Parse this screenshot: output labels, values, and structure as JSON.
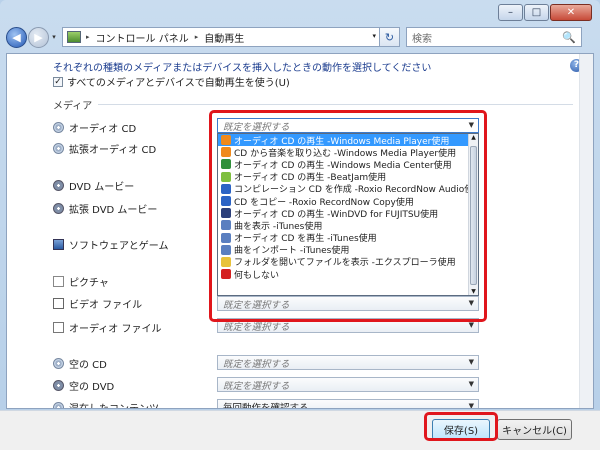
{
  "window": {
    "minimize": "–",
    "maximize": "□",
    "close": "✕"
  },
  "nav": {
    "back": "◀",
    "forward": "▶",
    "dropdown": "▾",
    "breadcrumb": [
      "コントロール パネル",
      "自動再生"
    ],
    "crumb_separator": "▸",
    "refresh": "↻",
    "search_placeholder": "検索",
    "search_icon": "search-icon"
  },
  "panel": {
    "help": "?",
    "instruction": "それぞれの種類のメディアまたはデバイスを挿入したときの動作を選択してください",
    "use_all_label": "すべてのメディアとデバイスで自動再生を使う(U)",
    "use_all_checked": true,
    "section_label": "メディア"
  },
  "media_rows": [
    {
      "label": "オーディオ CD",
      "icon": "audio-cd-icon",
      "value": "既定を選択する",
      "open": true
    },
    {
      "label": "拡張オーディオ CD",
      "icon": "enhanced-audio-cd-icon",
      "value": ""
    },
    {
      "label": "DVD ムービー",
      "icon": "dvd-movie-icon",
      "value": ""
    },
    {
      "label": "拡張 DVD ムービー",
      "icon": "enhanced-dvd-movie-icon",
      "value": ""
    },
    {
      "label": "ソフトウェアとゲーム",
      "icon": "software-games-icon",
      "value": ""
    },
    {
      "label": "ピクチャ",
      "icon": "pictures-icon",
      "value": ""
    },
    {
      "label": "ビデオ ファイル",
      "icon": "video-files-icon",
      "value": "既定を選択する"
    },
    {
      "label": "オーディオ ファイル",
      "icon": "audio-files-icon",
      "value": "既定を選択する"
    },
    {
      "label": "空の CD",
      "icon": "blank-cd-icon",
      "value": "既定を選択する"
    },
    {
      "label": "空の DVD",
      "icon": "blank-dvd-icon",
      "value": "既定を選択する"
    },
    {
      "label": "混在したコンテンツ",
      "icon": "mixed-content-icon",
      "value": "毎回動作を確認する"
    }
  ],
  "dropdown_options": [
    {
      "label": "オーディオ CD の再生 -Windows Media Player使用",
      "color": "#f08a1c",
      "selected": true
    },
    {
      "label": "CD から音楽を取り込む -Windows Media Player使用",
      "color": "#f08a1c"
    },
    {
      "label": "オーディオ CD の再生 -Windows Media Center使用",
      "color": "#2f8f3a"
    },
    {
      "label": "オーディオ CD の再生 -BeatJam使用",
      "color": "#7fbf3f"
    },
    {
      "label": "コンピレーション CD を作成 -Roxio RecordNow Audio使用",
      "color": "#2b63c5"
    },
    {
      "label": "CD をコピー -Roxio RecordNow Copy使用",
      "color": "#2b63c5"
    },
    {
      "label": "オーディオ CD の再生 -WinDVD for FUJITSU使用",
      "color": "#2b3f7a"
    },
    {
      "label": "曲を表示 -iTunes使用",
      "color": "#5a7fc0"
    },
    {
      "label": "オーディオ CD を再生 -iTunes使用",
      "color": "#5a7fc0"
    },
    {
      "label": "曲をインポート -iTunes使用",
      "color": "#5a7fc0"
    },
    {
      "label": "フォルダを開いてファイルを表示 -エクスプローラ使用",
      "color": "#e8c23a"
    },
    {
      "label": "何もしない",
      "color": "#d42020"
    }
  ],
  "footer": {
    "save": "保存(S)",
    "cancel": "キャンセル(C)"
  },
  "highlight_color": "#e0161c"
}
